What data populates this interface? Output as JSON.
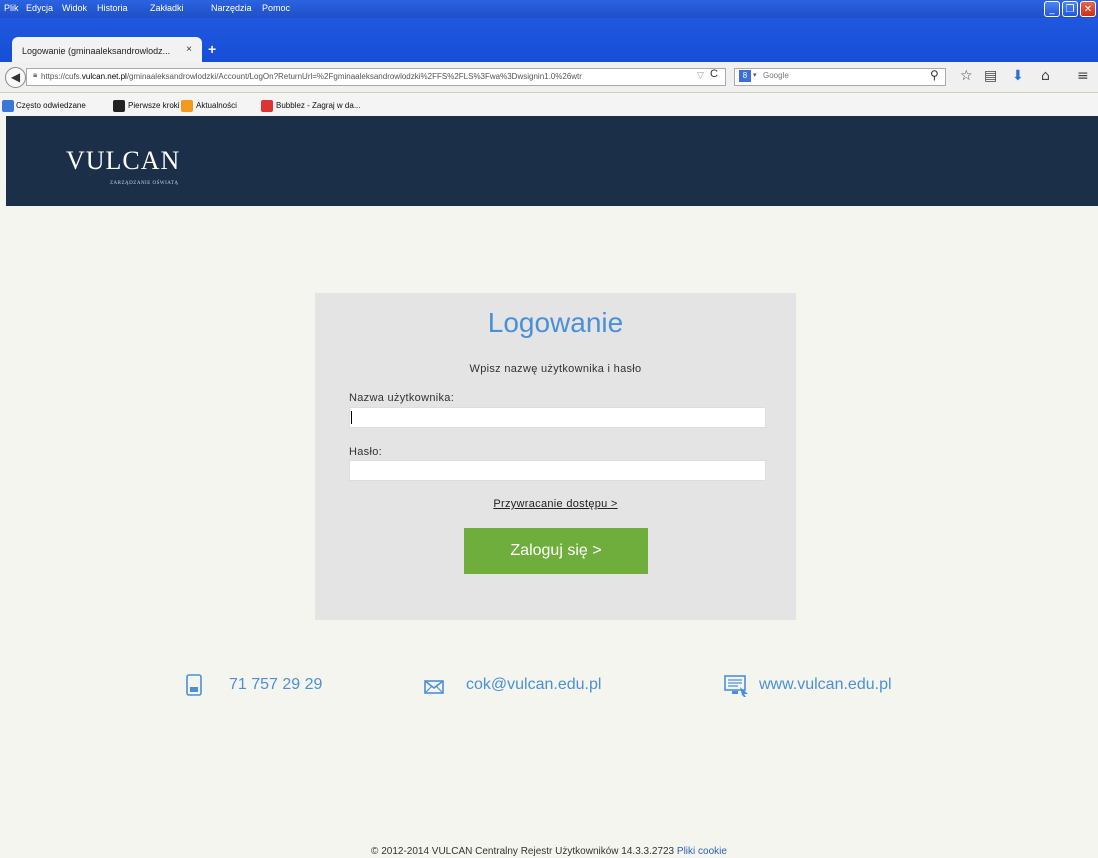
{
  "menu": [
    "Plik",
    "Edycja",
    "Widok",
    "Historia",
    "Zakładki",
    "Narzędzia",
    "Pomoc"
  ],
  "tab": {
    "title": "Logowanie (gminaaleksandrowlodz...",
    "close": "×",
    "new": "+"
  },
  "nav": {
    "url_prefix": "https://cufs.",
    "url_domain": "vulcan.net.pl",
    "url_rest": "/gminaaleksandrowlodzki/Account/LogOn?ReturnUrl=%2Fgminaaleksandrowlodzki%2FFS%2FLS%3Fwa%3Dwsignin1.0%26wtr",
    "search_placeholder": "Google"
  },
  "bookmarks": [
    "Często odwiedzane",
    "Pierwsze kroki",
    "Aktualności",
    "Bubblez - Zagraj w da..."
  ],
  "header": {
    "logo": "VULCAN",
    "logo_sub": "ZARZĄDZANIE OŚWIATĄ"
  },
  "login": {
    "title": "Logowanie",
    "subtitle": "Wpisz nazwę użytkownika i hasło",
    "username_label": "Nazwa użytkownika:",
    "password_label": "Hasło:",
    "forgot": "Przywracanie dostępu >",
    "submit": "Zaloguj się >"
  },
  "contact": {
    "phone": "71 757 29 29",
    "email": "cok@vulcan.edu.pl",
    "web": "www.vulcan.edu.pl"
  },
  "footer": {
    "text": "© 2012-2014 VULCAN Centralny Rejestr Użytkowników 14.3.3.2723",
    "cookie": "Pliki cookie"
  },
  "colors": {
    "header_bg": "#1b3048",
    "accent_blue": "#4a90d9",
    "button_green": "#6fae3c",
    "card_bg": "#e4e4e4"
  }
}
